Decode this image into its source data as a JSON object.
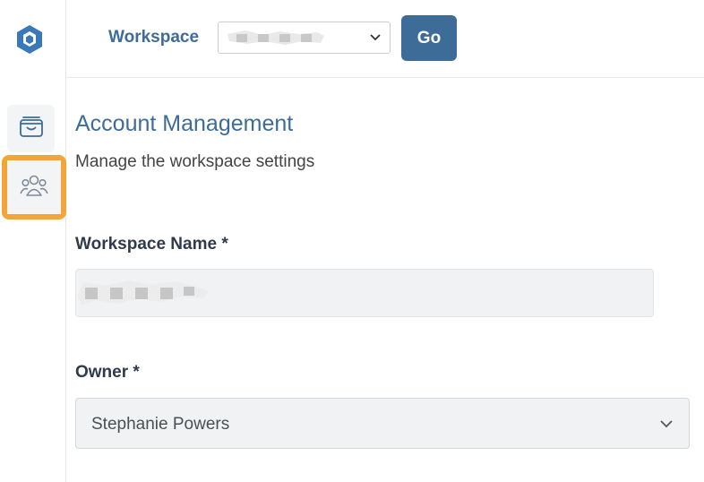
{
  "sidebar": {
    "logo_icon": "hexagon-logo-icon",
    "items": [
      {
        "icon": "wallet-icon"
      },
      {
        "icon": "users-icon",
        "highlighted": true
      }
    ],
    "highlight_color": "#f4a53a"
  },
  "topbar": {
    "workspace_label": "Workspace",
    "workspace_selected": "",
    "go_label": "Go"
  },
  "main": {
    "title": "Account Management",
    "subtitle": "Manage the workspace settings",
    "workspace_name_label": "Workspace Name *",
    "workspace_name_value": "",
    "owner_label": "Owner *",
    "owner_value": "Stephanie Powers"
  },
  "colors": {
    "accent": "#3e6c98",
    "logo": "#3a78b8"
  }
}
